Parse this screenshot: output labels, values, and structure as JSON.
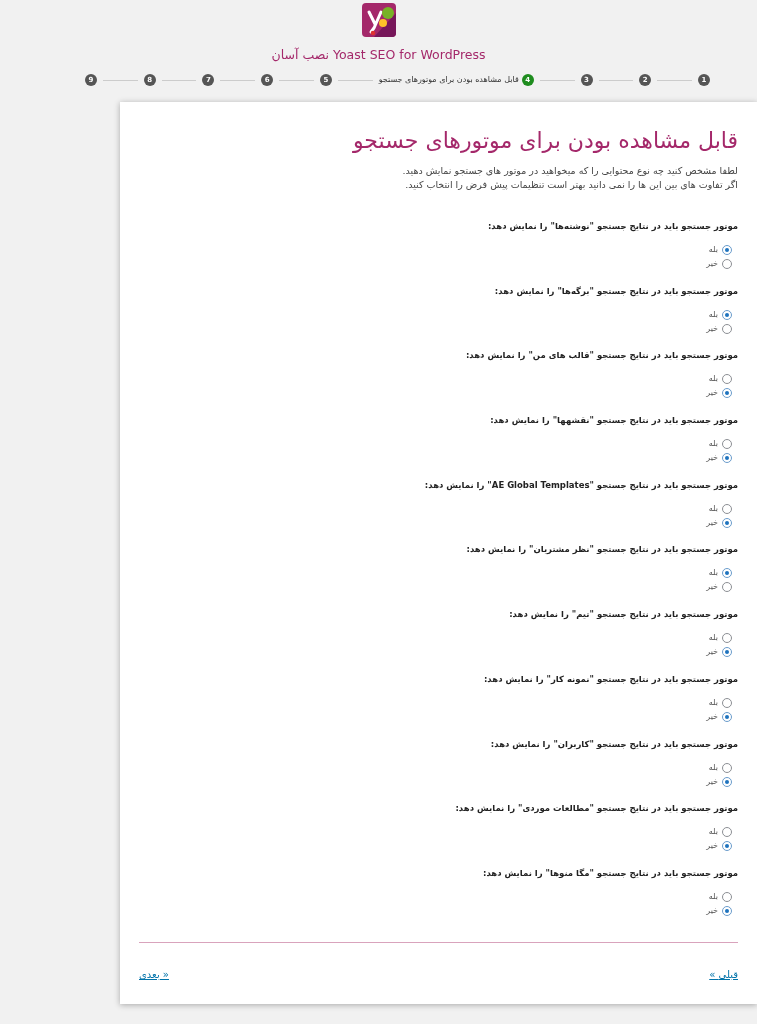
{
  "header": {
    "title": "Yoast SEO for WordPress نصب آسان"
  },
  "steps": [
    {
      "number": "1",
      "selected": false
    },
    {
      "number": "2",
      "selected": false
    },
    {
      "number": "3",
      "selected": false
    },
    {
      "number": "4",
      "label": "قابل مشاهده بودن برای موتورهای جستجو",
      "selected": true
    },
    {
      "number": "5",
      "selected": false
    },
    {
      "number": "6",
      "selected": false
    },
    {
      "number": "7",
      "selected": false
    },
    {
      "number": "8",
      "selected": false
    },
    {
      "number": "9",
      "selected": false
    }
  ],
  "card": {
    "title": "قابل مشاهده بودن برای موتورهای جستجو",
    "intro": [
      "لطفا مشخص کنید چه نوع محتوایی را که میخواهید در موتور های جستجو نمایش دهید.",
      "اگر تفاوت های بین این ها را نمی دانید بهتر است تنظیمات پیش فرض را انتخاب کنید."
    ]
  },
  "questions": [
    {
      "label": "موتور جستجو باید در نتایج جستجو \"نوشته‌ها\" را نمایش دهد:",
      "options": [
        {
          "label": "بله",
          "selected": true
        },
        {
          "label": "خیر",
          "selected": false
        }
      ]
    },
    {
      "label": "موتور جستجو باید در نتایج جستجو \"برگه‌ها\" را نمایش دهد:",
      "options": [
        {
          "label": "بله",
          "selected": true
        },
        {
          "label": "خیر",
          "selected": false
        }
      ]
    },
    {
      "label": "موتور جستجو باید در نتایج جستجو \"قالب های من\" را نمایش دهد:",
      "options": [
        {
          "label": "بله",
          "selected": false
        },
        {
          "label": "خیر",
          "selected": true
        }
      ]
    },
    {
      "label": "موتور جستجو باید در نتایج جستجو \"نقشهها\" را نمایش دهد:",
      "options": [
        {
          "label": "بله",
          "selected": false
        },
        {
          "label": "خیر",
          "selected": true
        }
      ]
    },
    {
      "label": "موتور جستجو باید در نتایج جستجو \"AE Global Templates\" را نمایش دهد:",
      "options": [
        {
          "label": "بله",
          "selected": false
        },
        {
          "label": "خیر",
          "selected": true
        }
      ]
    },
    {
      "label": "موتور جستجو باید در نتایج جستجو \"نظر مشتریان\" را نمایش دهد:",
      "options": [
        {
          "label": "بله",
          "selected": true
        },
        {
          "label": "خیر",
          "selected": false
        }
      ]
    },
    {
      "label": "موتور جستجو باید در نتایج جستجو \"تیم\" را نمایش دهد:",
      "options": [
        {
          "label": "بله",
          "selected": false
        },
        {
          "label": "خیر",
          "selected": true
        }
      ]
    },
    {
      "label": "موتور جستجو باید در نتایج جستجو \"نمونه کار\" را نمایش دهد:",
      "options": [
        {
          "label": "بله",
          "selected": false
        },
        {
          "label": "خیر",
          "selected": true
        }
      ]
    },
    {
      "label": "موتور جستجو باید در نتایج جستجو \"کاربران\" را نمایش دهد:",
      "options": [
        {
          "label": "بله",
          "selected": false
        },
        {
          "label": "خیر",
          "selected": true
        }
      ]
    },
    {
      "label": "موتور جستجو باید در نتایج جستجو \"مطالعات موردی\" را نمایش دهد:",
      "options": [
        {
          "label": "بله",
          "selected": false
        },
        {
          "label": "خیر",
          "selected": true
        }
      ]
    },
    {
      "label": "موتور جستجو باید در نتایج جستجو \"مگا منوها\" را نمایش دهد:",
      "options": [
        {
          "label": "بله",
          "selected": false
        },
        {
          "label": "خیر",
          "selected": true
        }
      ]
    }
  ],
  "navigation": {
    "previous": "« قبلی",
    "next": "بعدی »"
  }
}
